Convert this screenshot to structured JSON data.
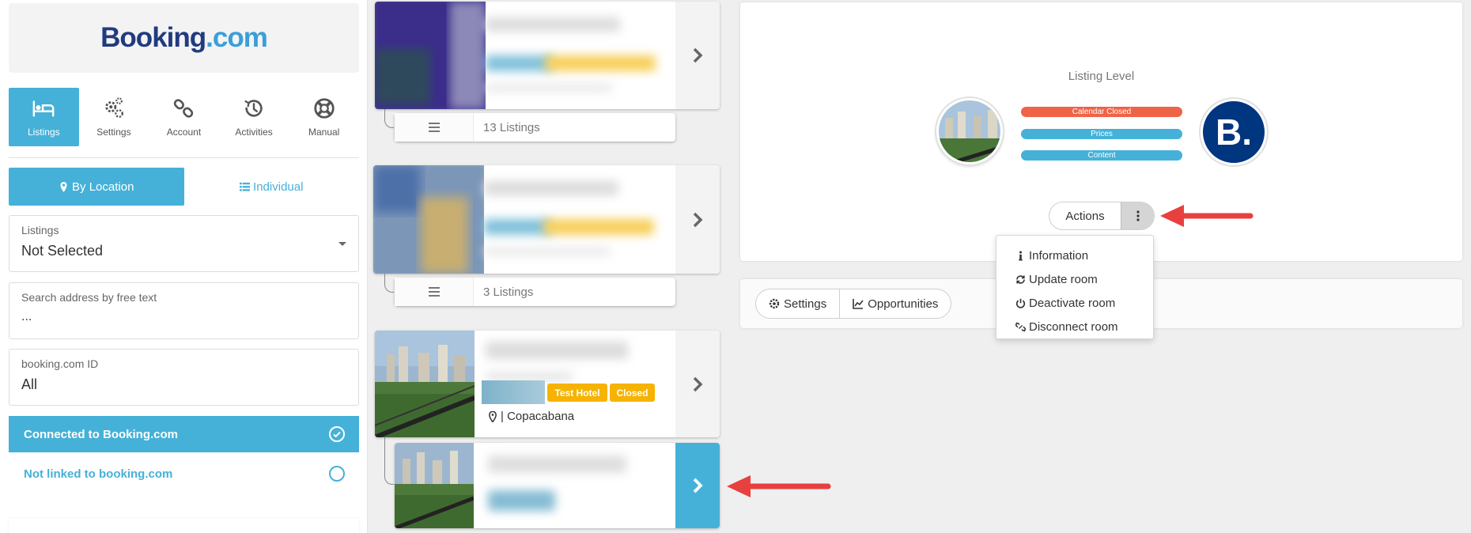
{
  "logo": {
    "part1": "Booking",
    "part2": ".com"
  },
  "nav": {
    "items": [
      {
        "label": "Listings",
        "icon": "bed-icon",
        "active": true
      },
      {
        "label": "Settings",
        "icon": "gears-icon",
        "active": false
      },
      {
        "label": "Account",
        "icon": "link-icon",
        "active": false
      },
      {
        "label": "Activities",
        "icon": "history-icon",
        "active": false
      },
      {
        "label": "Manual",
        "icon": "lifebuoy-icon",
        "active": false
      }
    ]
  },
  "view_toggle": {
    "by_location": "By Location",
    "individual": "Individual"
  },
  "filters": {
    "listings": {
      "label": "Listings",
      "value": "Not Selected"
    },
    "search": {
      "label": "Search address by free text",
      "value": "..."
    },
    "booking_id": {
      "label": "booking.com ID",
      "value": "All"
    }
  },
  "status": {
    "connected": "Connected to Booking.com",
    "not_linked": "Not linked to booking.com"
  },
  "groups": [
    {
      "count_label": "13 Listings"
    },
    {
      "count_label": "3 Listings"
    }
  ],
  "listing": {
    "badge1": "Test Hotel",
    "badge2": "Closed",
    "location": "| Copacabana"
  },
  "panel": {
    "title": "Listing Level",
    "pills": [
      "Calendar Closed",
      "Prices",
      "Content"
    ],
    "brand_letter": "B.",
    "actions_label": "Actions"
  },
  "dropdown": {
    "items": [
      {
        "label": "Information",
        "icon": "info-icon"
      },
      {
        "label": "Update room",
        "icon": "refresh-icon"
      },
      {
        "label": "Deactivate room",
        "icon": "power-icon"
      },
      {
        "label": "Disconnect room",
        "icon": "unlink-icon"
      }
    ]
  },
  "panel2": {
    "settings": "Settings",
    "opportunities": "Opportunities"
  },
  "colors": {
    "accent": "#45b1d8",
    "badge": "#f6b300",
    "pill_red": "#ef6347",
    "brand_blue": "#003580",
    "arrow_red": "#e8403e"
  }
}
